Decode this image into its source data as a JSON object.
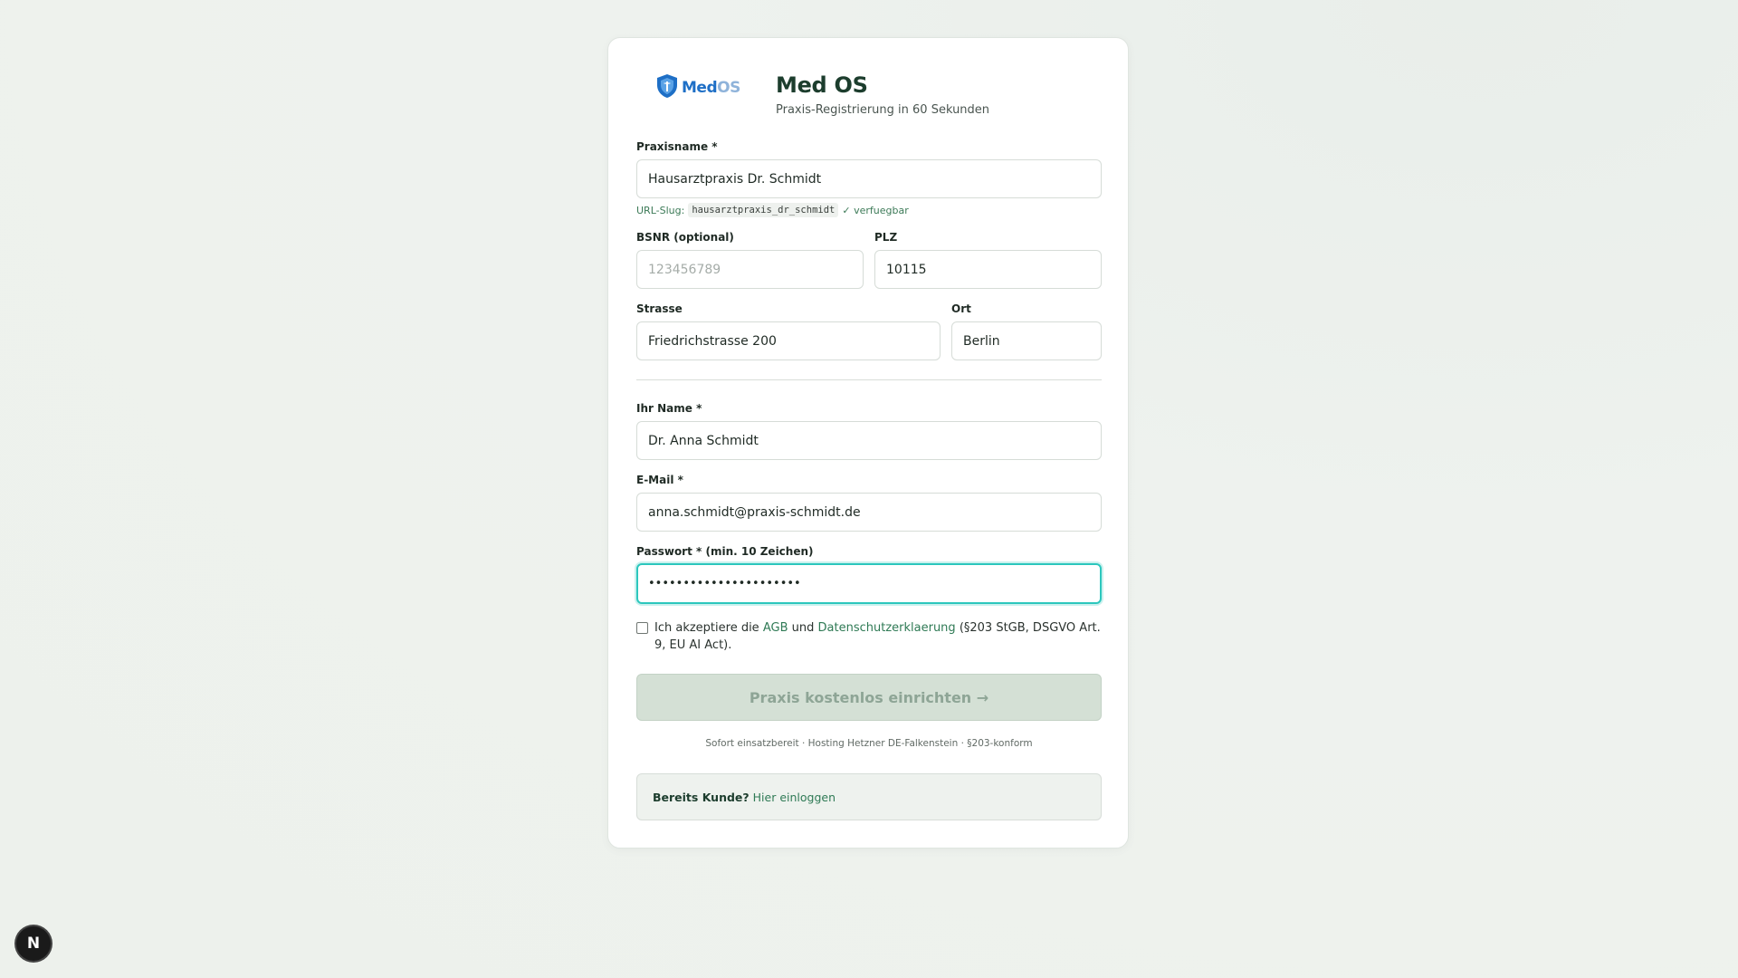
{
  "brand": {
    "logo_text_med": "Med",
    "logo_text_os": "OS",
    "title": "Med OS",
    "subtitle": "Praxis-Registrierung in 60 Sekunden"
  },
  "form": {
    "practice_name": {
      "label": "Praxisname *",
      "value": "Hausarztpraxis Dr. Schmidt"
    },
    "slug": {
      "prefix": "URL-Slug:",
      "value": "hausarztpraxis_dr_schmidt",
      "status": "✓ verfuegbar"
    },
    "bsnr": {
      "label": "BSNR (optional)",
      "value": "",
      "placeholder": "123456789"
    },
    "plz": {
      "label": "PLZ",
      "value": "10115"
    },
    "street": {
      "label": "Strasse",
      "value": "Friedrichstrasse 200"
    },
    "city": {
      "label": "Ort",
      "value": "Berlin"
    },
    "name": {
      "label": "Ihr Name *",
      "value": "Dr. Anna Schmidt"
    },
    "email": {
      "label": "E-Mail *",
      "value": "anna.schmidt@praxis-schmidt.de"
    },
    "password": {
      "label": "Passwort * (min. 10 Zeichen)",
      "value": "••••••••••••••••••••••"
    },
    "consent": {
      "checked": false,
      "text_before": "Ich akzeptiere die",
      "agb_link": "AGB",
      "text_middle": "und",
      "privacy_link": "Datenschutzerklaerung",
      "text_after": "(§203 StGB, DSGVO Art. 9, EU AI Act)."
    },
    "submit_label": "Praxis kostenlos einrichten →",
    "footnote": "Sofort einsatzbereit · Hosting Hetzner DE-Falkenstein · §203-konform"
  },
  "login": {
    "question": "Bereits Kunde?",
    "link": "Hier einloggen"
  },
  "dev_badge": {
    "letter": "N"
  },
  "colors": {
    "accent_green": "#2f7a55",
    "title_green": "#1c3d2d",
    "focus_ring": "#2cc7bd",
    "submit_disabled_bg": "#d4e0d5",
    "logo_blue": "#1e6fc6"
  }
}
